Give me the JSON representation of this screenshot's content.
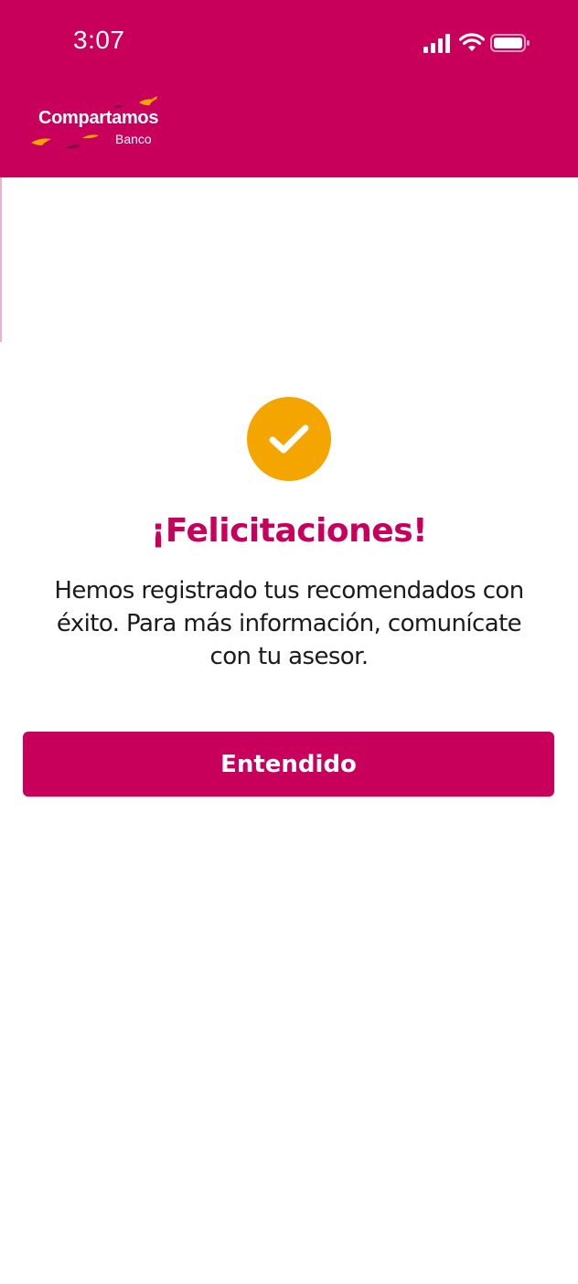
{
  "status_bar": {
    "time": "3:07",
    "icons": [
      "cellular-signal-icon",
      "wifi-icon",
      "battery-icon"
    ]
  },
  "header": {
    "logo_title": "Compartamos",
    "logo_subtitle": "Banco"
  },
  "dialog": {
    "icon": "check-icon",
    "title": "¡Felicitaciones!",
    "message": "Hemos registrado tus recomendados con éxito. Para más información, comunícate con tu asesor.",
    "button_label": "Entendido"
  },
  "colors": {
    "brand": "#c8005b",
    "check": "#f5a500",
    "text": "#1b1b1b",
    "background": "#ffffff"
  }
}
